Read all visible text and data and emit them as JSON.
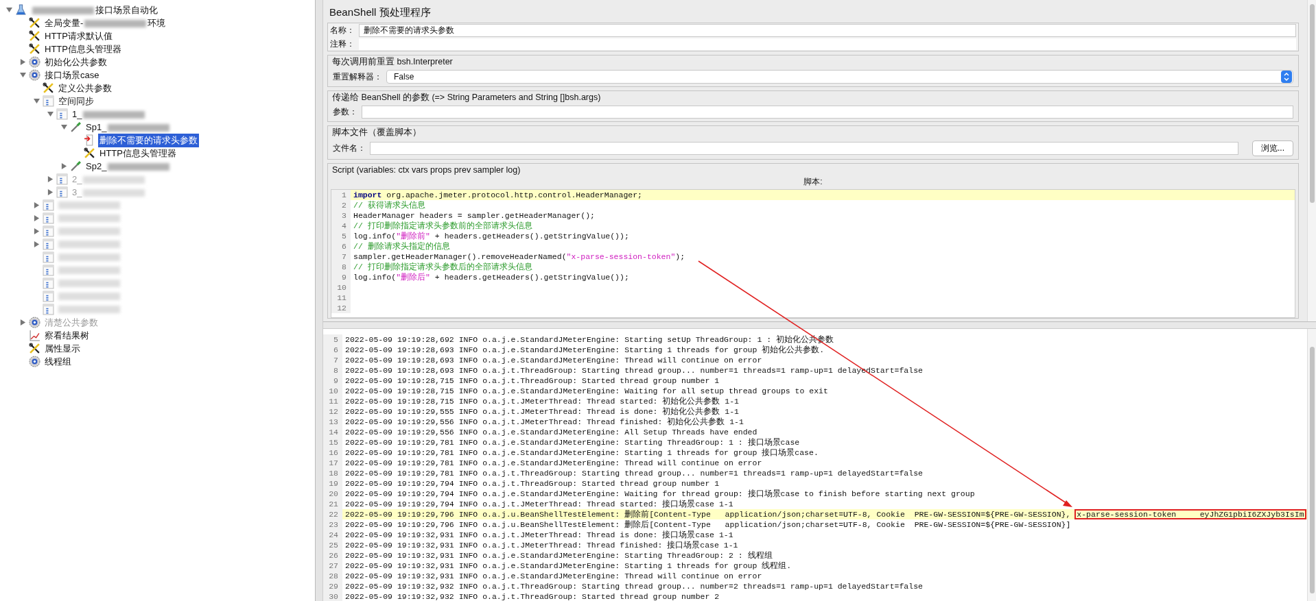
{
  "tree": [
    {
      "kind": "plan",
      "parts": [
        {
          "kind": "blurred"
        },
        {
          "kind": "text",
          "text": "接口场景自动化"
        }
      ],
      "expanded": true,
      "selected": false,
      "disabled": false,
      "children": [
        {
          "kind": "config",
          "parts": [
            {
              "kind": "text",
              "text": "全局变量-"
            },
            {
              "kind": "blurred"
            },
            {
              "kind": "text",
              "text": "环境"
            }
          ],
          "selected": false,
          "disabled": false
        },
        {
          "kind": "config",
          "parts": [
            {
              "kind": "text",
              "text": "HTTP请求默认值"
            }
          ],
          "selected": false,
          "disabled": false
        },
        {
          "kind": "config",
          "parts": [
            {
              "kind": "text",
              "text": "HTTP信息头管理器"
            }
          ],
          "selected": false,
          "disabled": false
        },
        {
          "kind": "threadgroup",
          "parts": [
            {
              "kind": "text",
              "text": "初始化公共参数"
            }
          ],
          "expanded": false,
          "selected": false,
          "disabled": false
        },
        {
          "kind": "threadgroup",
          "parts": [
            {
              "kind": "text",
              "text": "接口场景case"
            }
          ],
          "expanded": true,
          "selected": false,
          "disabled": false,
          "children": [
            {
              "kind": "config",
              "parts": [
                {
                  "kind": "text",
                  "text": "定义公共参数"
                }
              ],
              "selected": false,
              "disabled": false
            },
            {
              "kind": "controller",
              "parts": [
                {
                  "kind": "text",
                  "text": "空间同步"
                }
              ],
              "expanded": true,
              "selected": false,
              "disabled": false,
              "children": [
                {
                  "kind": "controller",
                  "parts": [
                    {
                      "kind": "text",
                      "text": "1_"
                    },
                    {
                      "kind": "blurred"
                    }
                  ],
                  "expanded": true,
                  "selected": false,
                  "disabled": false,
                  "children": [
                    {
                      "kind": "sampler",
                      "parts": [
                        {
                          "kind": "text",
                          "text": "Sp1_"
                        },
                        {
                          "kind": "blurred"
                        }
                      ],
                      "expanded": true,
                      "selected": false,
                      "disabled": false,
                      "children": [
                        {
                          "kind": "preprocessor",
                          "parts": [
                            {
                              "kind": "text",
                              "text": "删除不需要的请求头参数"
                            }
                          ],
                          "selected": true,
                          "disabled": false
                        },
                        {
                          "kind": "config",
                          "parts": [
                            {
                              "kind": "text",
                              "text": "HTTP信息头管理器"
                            }
                          ],
                          "selected": false,
                          "disabled": false
                        }
                      ]
                    },
                    {
                      "kind": "sampler",
                      "parts": [
                        {
                          "kind": "text",
                          "text": "Sp2_"
                        },
                        {
                          "kind": "blurred"
                        }
                      ],
                      "expanded": false,
                      "selected": false,
                      "disabled": false
                    }
                  ]
                },
                {
                  "kind": "controller",
                  "parts": [
                    {
                      "kind": "text",
                      "text": "2_"
                    },
                    {
                      "kind": "blurred"
                    }
                  ],
                  "expanded": false,
                  "selected": false,
                  "disabled": true
                },
                {
                  "kind": "controller",
                  "parts": [
                    {
                      "kind": "text",
                      "text": "3_"
                    },
                    {
                      "kind": "blurred"
                    }
                  ],
                  "expanded": false,
                  "selected": false,
                  "disabled": true
                }
              ]
            },
            {
              "kind": "controller",
              "parts": [
                {
                  "kind": "blurred"
                }
              ],
              "expanded": false,
              "selected": false,
              "disabled": true
            },
            {
              "kind": "controller",
              "parts": [
                {
                  "kind": "blurred"
                }
              ],
              "expanded": false,
              "selected": false,
              "disabled": true
            },
            {
              "kind": "controller",
              "parts": [
                {
                  "kind": "blurred"
                }
              ],
              "expanded": false,
              "selected": false,
              "disabled": true
            },
            {
              "kind": "controller",
              "parts": [
                {
                  "kind": "blurred"
                }
              ],
              "expanded": false,
              "selected": false,
              "disabled": true
            },
            {
              "kind": "controller",
              "parts": [
                {
                  "kind": "blurred"
                }
              ],
              "selected": false,
              "disabled": true
            },
            {
              "kind": "controller",
              "parts": [
                {
                  "kind": "blurred"
                }
              ],
              "selected": false,
              "disabled": true
            },
            {
              "kind": "controller",
              "parts": [
                {
                  "kind": "blurred"
                }
              ],
              "selected": false,
              "disabled": true
            },
            {
              "kind": "controller",
              "parts": [
                {
                  "kind": "blurred"
                }
              ],
              "selected": false,
              "disabled": true
            },
            {
              "kind": "controller",
              "parts": [
                {
                  "kind": "blurred"
                }
              ],
              "selected": false,
              "disabled": true
            }
          ]
        },
        {
          "kind": "threadgroup",
          "parts": [
            {
              "kind": "text",
              "text": "清楚公共参数"
            }
          ],
          "expanded": false,
          "selected": false,
          "disabled": true
        },
        {
          "kind": "listener",
          "parts": [
            {
              "kind": "text",
              "text": "察看结果树"
            }
          ],
          "selected": false,
          "disabled": false
        },
        {
          "kind": "config",
          "parts": [
            {
              "kind": "text",
              "text": "属性显示"
            }
          ],
          "selected": false,
          "disabled": false
        },
        {
          "kind": "threadgroup",
          "parts": [
            {
              "kind": "text",
              "text": "线程组"
            }
          ],
          "selected": false,
          "disabled": false
        }
      ]
    }
  ],
  "panel": {
    "title": "BeanShell 预处理程序",
    "name_label": "名称：",
    "name_value": "删除不需要的请求头参数",
    "comment_label": "注释：",
    "reset_group": {
      "title": "每次调用前重置 bsh.Interpreter",
      "label": "重置解释器：",
      "value": "False"
    },
    "params_group": {
      "title": "传递给 BeanShell 的参数 (=> String Parameters and String []bsh.args)",
      "label": "参数："
    },
    "file_group": {
      "title": "脚本文件（覆盖脚本）",
      "label": "文件名：",
      "button": "浏览..."
    },
    "script_group": {
      "title": "Script (variables: ctx vars props prev sampler log)",
      "editor_label": "脚本:"
    }
  },
  "script_lines": [
    {
      "number": "1",
      "current": true,
      "tokens": [
        {
          "kind": "keyword",
          "text": "import"
        },
        {
          "kind": "plain",
          "text": " org.apache.jmeter.protocol.http.control.HeaderManager;"
        }
      ]
    },
    {
      "number": "2",
      "current": false,
      "tokens": [
        {
          "kind": "comment",
          "text": "// 获得请求头信息"
        }
      ]
    },
    {
      "number": "3",
      "current": false,
      "tokens": [
        {
          "kind": "plain",
          "text": "HeaderManager headers = sampler.getHeaderManager();"
        }
      ]
    },
    {
      "number": "4",
      "current": false,
      "tokens": [
        {
          "kind": "comment",
          "text": "// 打印删除指定请求头参数前的全部请求头信息"
        }
      ]
    },
    {
      "number": "5",
      "current": false,
      "tokens": [
        {
          "kind": "plain",
          "text": "log.info("
        },
        {
          "kind": "string",
          "text": "\"删除前\""
        },
        {
          "kind": "plain",
          "text": " + headers.getHeaders().getStringValue());"
        }
      ]
    },
    {
      "number": "6",
      "current": false,
      "tokens": [
        {
          "kind": "comment",
          "text": "// 删除请求头指定的信息"
        }
      ]
    },
    {
      "number": "7",
      "current": false,
      "tokens": [
        {
          "kind": "plain",
          "text": "sampler.getHeaderManager().removeHeaderNamed("
        },
        {
          "kind": "string",
          "text": "\"x-parse-session-token\""
        },
        {
          "kind": "plain",
          "text": ");"
        }
      ]
    },
    {
      "number": "8",
      "current": false,
      "tokens": [
        {
          "kind": "comment",
          "text": "// 打印删除指定请求头参数后的全部请求头信息"
        }
      ]
    },
    {
      "number": "9",
      "current": false,
      "tokens": [
        {
          "kind": "plain",
          "text": "log.info("
        },
        {
          "kind": "string",
          "text": "\"删除后\""
        },
        {
          "kind": "plain",
          "text": " + headers.getHeaders().getStringValue());"
        }
      ]
    },
    {
      "number": "10",
      "current": false
    },
    {
      "number": "11",
      "current": false
    },
    {
      "number": "12",
      "current": false
    }
  ],
  "log_lines": [
    {
      "number": "5",
      "highlighted": false,
      "text": "2022-05-09 19:19:28,692 INFO o.a.j.e.StandardJMeterEngine: Starting setUp ThreadGroup: 1 : 初始化公共参数"
    },
    {
      "number": "6",
      "highlighted": false,
      "text": "2022-05-09 19:19:28,693 INFO o.a.j.e.StandardJMeterEngine: Starting 1 threads for group 初始化公共参数."
    },
    {
      "number": "7",
      "highlighted": false,
      "text": "2022-05-09 19:19:28,693 INFO o.a.j.e.StandardJMeterEngine: Thread will continue on error"
    },
    {
      "number": "8",
      "highlighted": false,
      "text": "2022-05-09 19:19:28,693 INFO o.a.j.t.ThreadGroup: Starting thread group... number=1 threads=1 ramp-up=1 delayedStart=false"
    },
    {
      "number": "9",
      "highlighted": false,
      "text": "2022-05-09 19:19:28,715 INFO o.a.j.t.ThreadGroup: Started thread group number 1"
    },
    {
      "number": "10",
      "highlighted": false,
      "text": "2022-05-09 19:19:28,715 INFO o.a.j.e.StandardJMeterEngine: Waiting for all setup thread groups to exit"
    },
    {
      "number": "11",
      "highlighted": false,
      "text": "2022-05-09 19:19:28,715 INFO o.a.j.t.JMeterThread: Thread started: 初始化公共参数 1-1"
    },
    {
      "number": "12",
      "highlighted": false,
      "text": "2022-05-09 19:19:29,555 INFO o.a.j.t.JMeterThread: Thread is done: 初始化公共参数 1-1"
    },
    {
      "number": "13",
      "highlighted": false,
      "text": "2022-05-09 19:19:29,556 INFO o.a.j.t.JMeterThread: Thread finished: 初始化公共参数 1-1"
    },
    {
      "number": "14",
      "highlighted": false,
      "text": "2022-05-09 19:19:29,556 INFO o.a.j.e.StandardJMeterEngine: All Setup Threads have ended"
    },
    {
      "number": "15",
      "highlighted": false,
      "text": "2022-05-09 19:19:29,781 INFO o.a.j.e.StandardJMeterEngine: Starting ThreadGroup: 1 : 接口场景case"
    },
    {
      "number": "16",
      "highlighted": false,
      "text": "2022-05-09 19:19:29,781 INFO o.a.j.e.StandardJMeterEngine: Starting 1 threads for group 接口场景case."
    },
    {
      "number": "17",
      "highlighted": false,
      "text": "2022-05-09 19:19:29,781 INFO o.a.j.e.StandardJMeterEngine: Thread will continue on error"
    },
    {
      "number": "18",
      "highlighted": false,
      "text": "2022-05-09 19:19:29,781 INFO o.a.j.t.ThreadGroup: Starting thread group... number=1 threads=1 ramp-up=1 delayedStart=false"
    },
    {
      "number": "19",
      "highlighted": false,
      "text": "2022-05-09 19:19:29,794 INFO o.a.j.t.ThreadGroup: Started thread group number 1"
    },
    {
      "number": "20",
      "highlighted": false,
      "text": "2022-05-09 19:19:29,794 INFO o.a.j.e.StandardJMeterEngine: Waiting for thread group: 接口场景case to finish before starting next group"
    },
    {
      "number": "21",
      "highlighted": false,
      "text": "2022-05-09 19:19:29,794 INFO o.a.j.t.JMeterThread: Thread started: 接口场景case 1-1"
    },
    {
      "number": "22",
      "highlighted": true,
      "text": "2022-05-09 19:19:29,796 INFO o.a.j.u.BeanShellTestElement: 删除前[Content-Type   application/json;charset=UTF-8, Cookie  PRE-GW-SESSION=${PRE-GW-SESSION}, ",
      "boxed": "x-parse-session-token     eyJhZG1pbiI6ZXJyb3IsIm"
    },
    {
      "number": "23",
      "highlighted": false,
      "text": "2022-05-09 19:19:29,796 INFO o.a.j.u.BeanShellTestElement: 删除后[Content-Type   application/json;charset=UTF-8, Cookie  PRE-GW-SESSION=${PRE-GW-SESSION}]"
    },
    {
      "number": "24",
      "highlighted": false,
      "text": "2022-05-09 19:19:32,931 INFO o.a.j.t.JMeterThread: Thread is done: 接口场景case 1-1"
    },
    {
      "number": "25",
      "highlighted": false,
      "text": "2022-05-09 19:19:32,931 INFO o.a.j.t.JMeterThread: Thread finished: 接口场景case 1-1"
    },
    {
      "number": "26",
      "highlighted": false,
      "text": "2022-05-09 19:19:32,931 INFO o.a.j.e.StandardJMeterEngine: Starting ThreadGroup: 2 : 线程组"
    },
    {
      "number": "27",
      "highlighted": false,
      "text": "2022-05-09 19:19:32,931 INFO o.a.j.e.StandardJMeterEngine: Starting 1 threads for group 线程组."
    },
    {
      "number": "28",
      "highlighted": false,
      "text": "2022-05-09 19:19:32,931 INFO o.a.j.e.StandardJMeterEngine: Thread will continue on error"
    },
    {
      "number": "29",
      "highlighted": false,
      "text": "2022-05-09 19:19:32,932 INFO o.a.j.t.ThreadGroup: Starting thread group... number=2 threads=1 ramp-up=1 delayedStart=false"
    },
    {
      "number": "30",
      "highlighted": false,
      "text": "2022-05-09 19:19:32,932 INFO o.a.j.t.ThreadGroup: Started thread group number 2"
    }
  ]
}
